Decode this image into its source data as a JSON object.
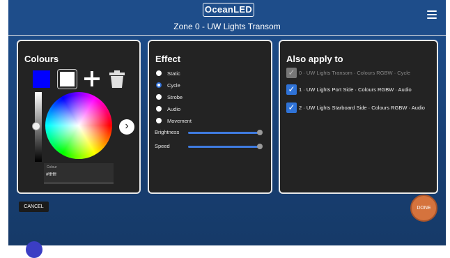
{
  "header": {
    "logo": "OceanLED",
    "title": "Zone 0 - UW Lights Transom"
  },
  "icons": {
    "menu": "hamburger-menu-icon",
    "add": "plus-icon",
    "delete": "trash-icon",
    "next": "chevron-right-icon"
  },
  "colours": {
    "title": "Colours",
    "swatches": [
      {
        "color": "#0000ff",
        "selected": false
      },
      {
        "color": "#ffffff",
        "selected": true
      }
    ],
    "brightness_bar_level_pct": 55,
    "field_label": "Colour",
    "field_value": "#ffffff"
  },
  "effect": {
    "title": "Effect",
    "options": [
      "Static",
      "Cycle",
      "Strobe",
      "Audio",
      "Movement"
    ],
    "selected": "Cycle",
    "sliders": [
      {
        "label": "Brightness",
        "value_pct": 100
      },
      {
        "label": "Speed",
        "value_pct": 100
      }
    ]
  },
  "apply": {
    "title": "Also apply to",
    "rows": [
      {
        "text": "0 · UW Lights Transom · Colours RGBW · Cycle",
        "checked": true,
        "disabled": true
      },
      {
        "text": "1 · UW Lights Port Side · Colours RGBW · Audio",
        "checked": true,
        "disabled": false
      },
      {
        "text": "2 · UW Lights Starboard Side · Colours RGBW · Audio",
        "checked": true,
        "disabled": false
      }
    ]
  },
  "buttons": {
    "cancel": "CANCEL",
    "done": "DONE"
  },
  "accent": {
    "done": "#d5733d",
    "checkbox": "#2f73d8",
    "header": "#1e4d8a"
  }
}
